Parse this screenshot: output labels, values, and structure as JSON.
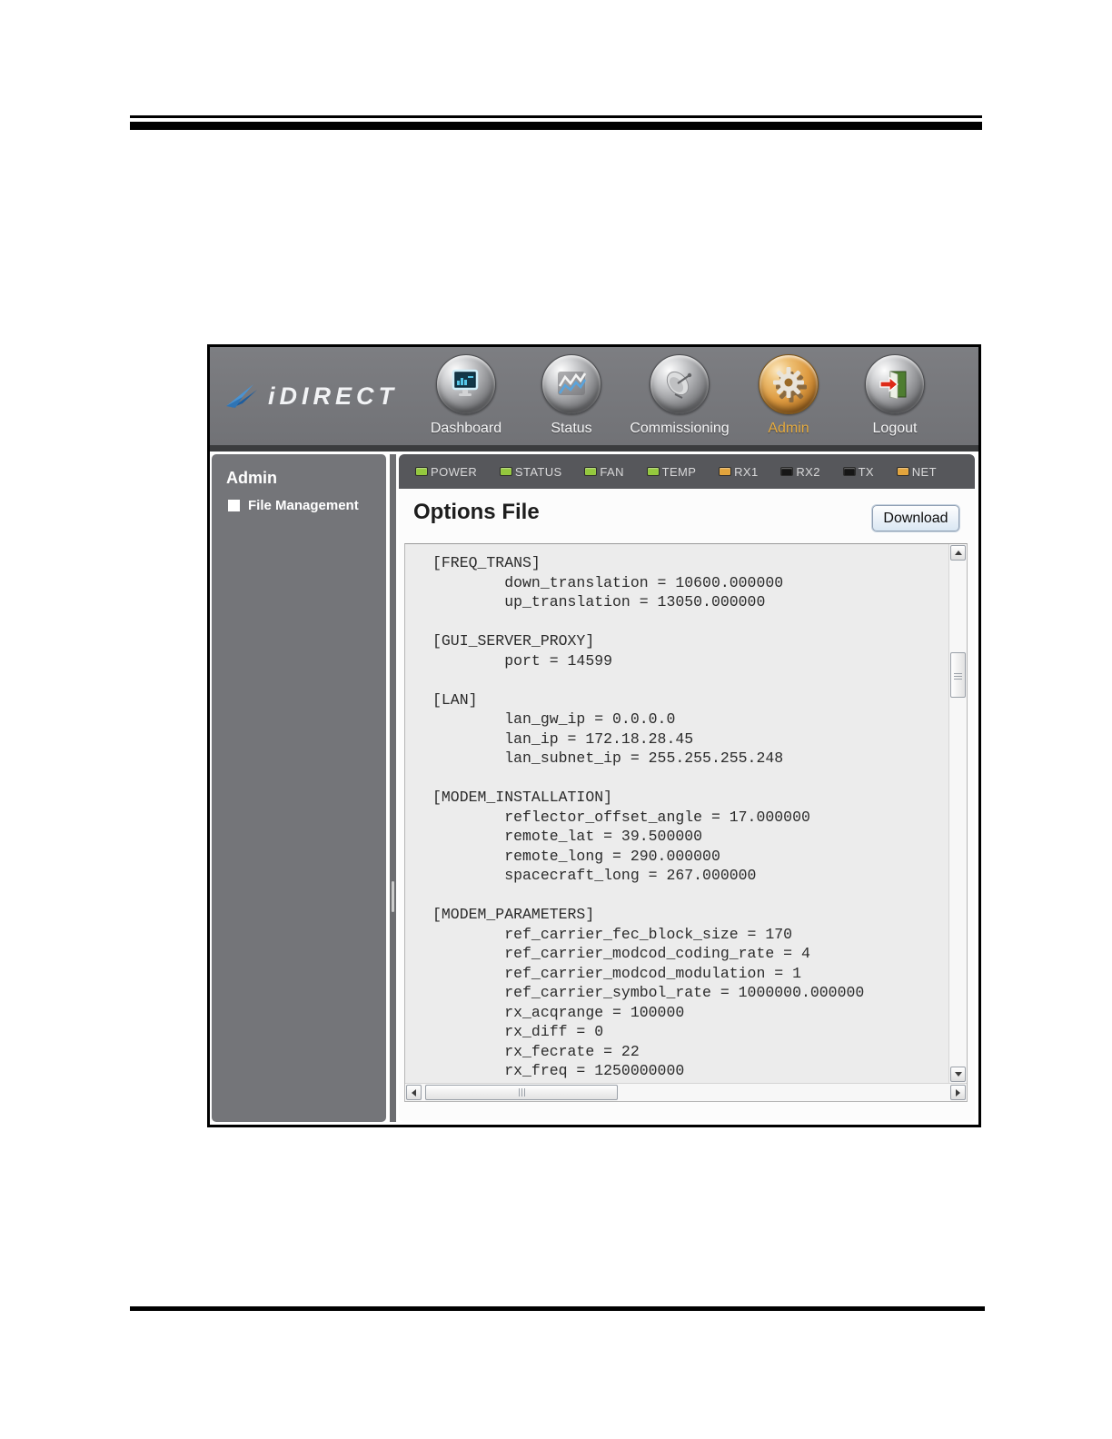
{
  "nav": {
    "logo_text": "iDIRECT",
    "active_color": "#e6ab3f",
    "items": [
      {
        "label": "Dashboard",
        "icon": "dashboard-monitor-icon"
      },
      {
        "label": "Status",
        "icon": "status-chart-icon"
      },
      {
        "label": "Commissioning",
        "icon": "satellite-dish-icon"
      },
      {
        "label": "Admin",
        "icon": "gear-icon"
      },
      {
        "label": "Logout",
        "icon": "logout-door-icon"
      }
    ]
  },
  "status_bar": {
    "colors": {
      "green": "#94c83d",
      "amber": "#e2a43c",
      "off": "#161616"
    },
    "indicators": [
      {
        "label": "POWER",
        "state": "green"
      },
      {
        "label": "STATUS",
        "state": "green"
      },
      {
        "label": "FAN",
        "state": "green"
      },
      {
        "label": "TEMP",
        "state": "green"
      },
      {
        "label": "RX1",
        "state": "amber"
      },
      {
        "label": "RX2",
        "state": "off"
      },
      {
        "label": "TX",
        "state": "off"
      },
      {
        "label": "NET",
        "state": "amber"
      }
    ]
  },
  "sidebar": {
    "title": "Admin",
    "items": [
      {
        "label": "File Management"
      }
    ]
  },
  "main": {
    "title": "Options File",
    "download_label": "Download",
    "file_lines": [
      "[FREQ_TRANS]",
      "        down_translation = 10600.000000",
      "        up_translation = 13050.000000",
      "",
      "[GUI_SERVER_PROXY]",
      "        port = 14599",
      "",
      "[LAN]",
      "        lan_gw_ip = 0.0.0.0",
      "        lan_ip = 172.18.28.45",
      "        lan_subnet_ip = 255.255.255.248",
      "",
      "[MODEM_INSTALLATION]",
      "        reflector_offset_angle = 17.000000",
      "        remote_lat = 39.500000",
      "        remote_long = 290.000000",
      "        spacecraft_long = 267.000000",
      "",
      "[MODEM_PARAMETERS]",
      "        ref_carrier_fec_block_size = 170",
      "        ref_carrier_modcod_coding_rate = 4",
      "        ref_carrier_modcod_modulation = 1",
      "        ref_carrier_symbol_rate = 1000000.000000",
      "        rx_acqrange = 100000",
      "        rx_diff = 0",
      "        rx_fecrate = 22",
      "        rx_freq = 1250000000"
    ]
  }
}
